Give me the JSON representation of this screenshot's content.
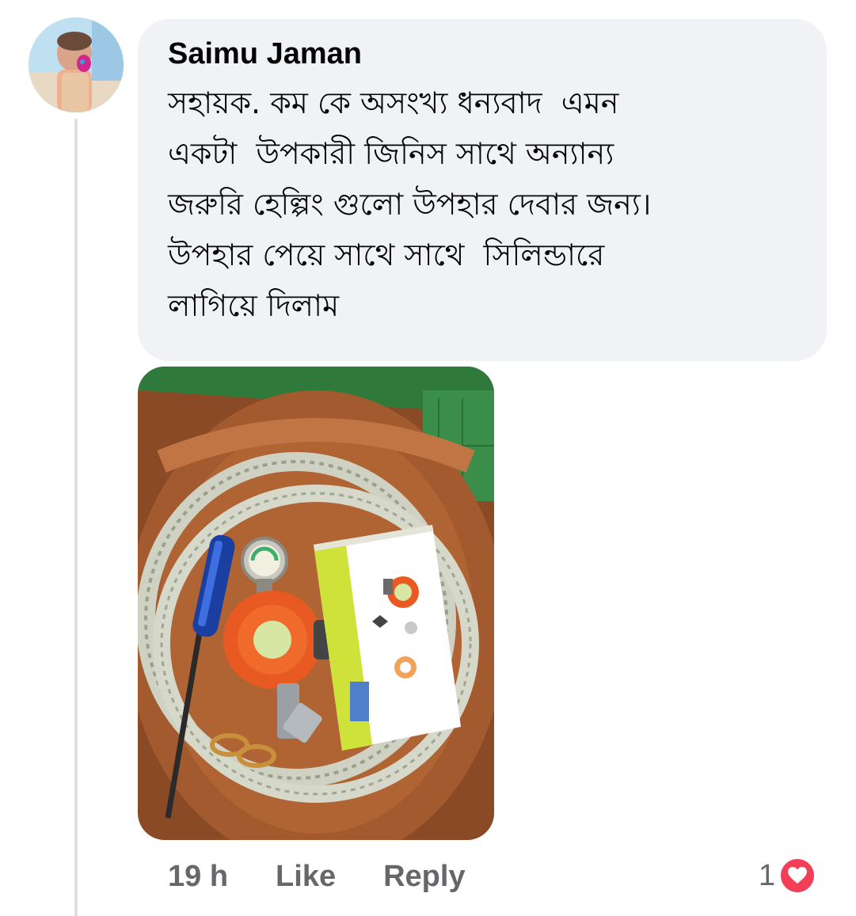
{
  "comment": {
    "author": "Saimu Jaman",
    "text": "সহায়ক. কম কে অসংখ্য ধন্যবাদ  এমন\nএকটা  উপকারী জিনিস সাথে অন্যান্য\nজরুরি হেল্পিং গুলো উপহার দেবার জন্য।\nউপহার পেয়ে সাথে সাথে  সিলিন্ডারে\nলাগিয়ে দিলাম",
    "timestamp": "19 h",
    "like_label": "Like",
    "reply_label": "Reply",
    "reaction_count": "1",
    "reaction_icon": "love-reaction-icon"
  },
  "colors": {
    "bubble": "#f0f2f5",
    "meta_text": "#65676b",
    "love": "#f33e58"
  }
}
